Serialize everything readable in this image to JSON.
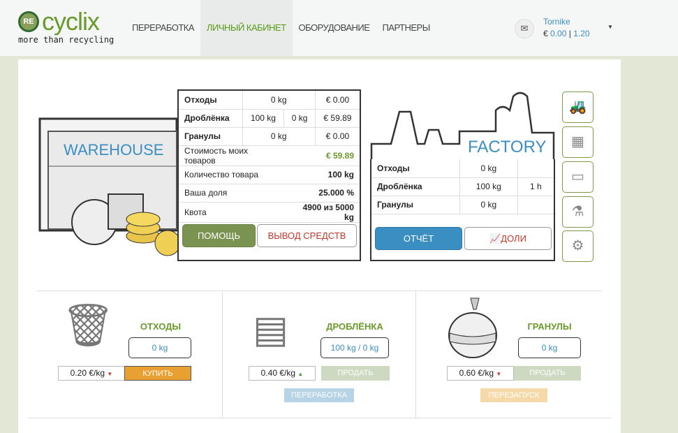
{
  "header": {
    "logo_badge": "RE",
    "logo_name": "cyclix",
    "logo_tagline": "more than recycling",
    "nav": [
      {
        "label": "ПЕРЕРАБОТКА"
      },
      {
        "label": "ЛИЧНЫЙ КАБИНЕТ",
        "active": true
      },
      {
        "label": "ОБОРУДОВАНИЕ"
      },
      {
        "label": "ПАРТНЕРЫ"
      }
    ],
    "user": {
      "name": "Tornike",
      "currency": "€",
      "balance": "0.00",
      "separator": "|",
      "share": "1.20"
    }
  },
  "warehouse": {
    "label": "WAREHOUSE",
    "rows": [
      {
        "name": "Отходы",
        "qty": "0 kg",
        "value": "€ 0.00"
      },
      {
        "name": "Дроблёнка",
        "qty": "100 kg",
        "qty2": "0 kg",
        "value": "€ 59.89"
      },
      {
        "name": "Гранулы",
        "qty": "0 kg",
        "value": "€ 0.00"
      }
    ],
    "stats": [
      {
        "label": "Стоимость моих товаров",
        "value": "€ 59.89"
      },
      {
        "label": "Количество товара",
        "value": "100 kg"
      },
      {
        "label": "Ваша доля",
        "value": "25.000 %"
      },
      {
        "label": "Квота",
        "value": "4900 из 5000 kg"
      }
    ],
    "help_button": "ПОМОЩЬ",
    "withdraw_button": "ВЫВОД СРЕДСТВ"
  },
  "factory": {
    "label": "FACTORY",
    "rows": [
      {
        "name": "Отходы",
        "qty": "0 kg",
        "time": ""
      },
      {
        "name": "Дроблёнка",
        "qty": "100 kg",
        "time": "1 h"
      },
      {
        "name": "Гранулы",
        "qty": "0 kg",
        "time": ""
      }
    ],
    "report_button": "ОТЧЁТ",
    "shares_button": "ДОЛИ"
  },
  "products": [
    {
      "title": "ОТХОДЫ",
      "qty": "0 kg",
      "price": "0.20 €/kg",
      "trend": "down",
      "action": "КУПИТЬ"
    },
    {
      "title": "ДРОБЛЁНКА",
      "qty": "100 kg / 0 kg",
      "price": "0.40 €/kg",
      "trend": "up",
      "action": "ПРОДАТЬ",
      "secondary": "ПЕРЕРАБОТКА"
    },
    {
      "title": "ГРАНУЛЫ",
      "qty": "0 kg",
      "price": "0.60 €/kg",
      "trend": "down",
      "action": "ПРОДАТЬ",
      "secondary": "ПЕРЕЗАПУСК"
    }
  ],
  "colors": {
    "green": "#6b9a2c",
    "blue": "#3b8ec2",
    "orange": "#e8a030",
    "red": "#c0392b"
  }
}
